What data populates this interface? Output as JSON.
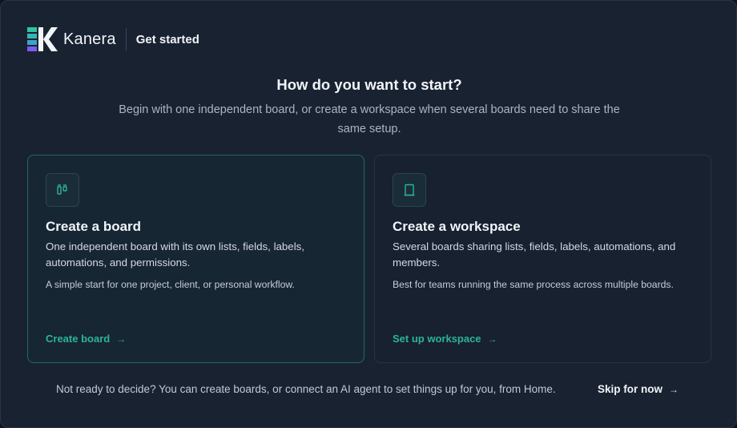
{
  "header": {
    "brand": "Kanera",
    "section_title": "Get started"
  },
  "main": {
    "heading": "How do you want to start?",
    "subheading": "Begin with one independent board, or create a workspace when several boards need to share the same setup."
  },
  "options": [
    {
      "title": "Create a board",
      "description": "One independent board with its own lists, fields, labels, automations, and permissions.",
      "note": "A simple start for one project, client, or personal workflow.",
      "action": "Create board",
      "icon": "board-icon",
      "selected": true
    },
    {
      "title": "Create a workspace",
      "description": "Several boards sharing lists, fields, labels, automations, and members.",
      "note": "Best for teams running the same process across multiple boards.",
      "action": "Set up workspace",
      "icon": "building-icon",
      "selected": false
    }
  ],
  "footer": {
    "text": "Not ready to decide? You can create boards, or connect an AI agent to set things up for you, from Home.",
    "skip_label": "Skip for now"
  },
  "icons": {
    "arrow": "→"
  },
  "colors": {
    "background": "#192231",
    "accent": "#2bb39b",
    "selected_border": "#1f6b62",
    "logo_green": "#2ec4a0",
    "logo_teal": "#3aa6c8",
    "logo_purple": "#7a5cf0"
  }
}
